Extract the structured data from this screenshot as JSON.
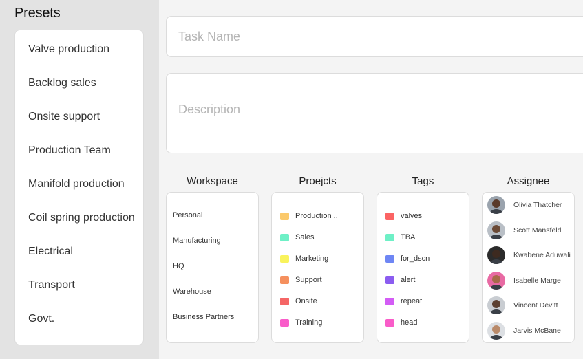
{
  "presets": {
    "title": "Presets",
    "items": [
      "Valve production",
      "Backlog sales",
      "Onsite support",
      "Production Team",
      "Manifold production",
      "Coil spring production",
      "Electrical",
      "Transport",
      "Govt."
    ]
  },
  "form": {
    "task_placeholder": "Task Name",
    "description_placeholder": "Description"
  },
  "workspace": {
    "title": "Workspace",
    "items": [
      "Personal",
      "Manufacturing",
      "HQ",
      "Warehouse",
      "Business Partners"
    ]
  },
  "projects": {
    "title": "Proejcts",
    "items": [
      {
        "label": "Production ..",
        "color": "#fbc96b"
      },
      {
        "label": "Sales",
        "color": "#6ef0c6"
      },
      {
        "label": "Marketing",
        "color": "#f9f35c"
      },
      {
        "label": "Support",
        "color": "#f5905e"
      },
      {
        "label": "Onsite",
        "color": "#f56666"
      },
      {
        "label": "Training",
        "color": "#f95cc9"
      }
    ]
  },
  "tags": {
    "title": "Tags",
    "items": [
      {
        "label": "valves",
        "color": "#fb6464"
      },
      {
        "label": "TBA",
        "color": "#6ef0c6"
      },
      {
        "label": "for_dscn",
        "color": "#6e86f4"
      },
      {
        "label": "alert",
        "color": "#8b5cf0"
      },
      {
        "label": "repeat",
        "color": "#d35cf5"
      },
      {
        "label": "head",
        "color": "#f95cc9"
      }
    ]
  },
  "assignee": {
    "title": "Assignee",
    "items": [
      {
        "name": "Olivia Thatcher",
        "skin": "#5a3a2a",
        "bg": "#9aa3ad"
      },
      {
        "name": "Scott Mansfeld",
        "skin": "#6b4a36",
        "bg": "#b9bfc6"
      },
      {
        "name": "Kwabene Aduwali",
        "skin": "#3d2a20",
        "bg": "#2b2b2b"
      },
      {
        "name": "Isabelle Marge",
        "skin": "#a86a4a",
        "bg": "#e86aa3"
      },
      {
        "name": "Vincent Devitt",
        "skin": "#5c4032",
        "bg": "#c9cdd2"
      },
      {
        "name": "Jarvis McBane",
        "skin": "#b98a6a",
        "bg": "#dcdfe3"
      }
    ]
  }
}
